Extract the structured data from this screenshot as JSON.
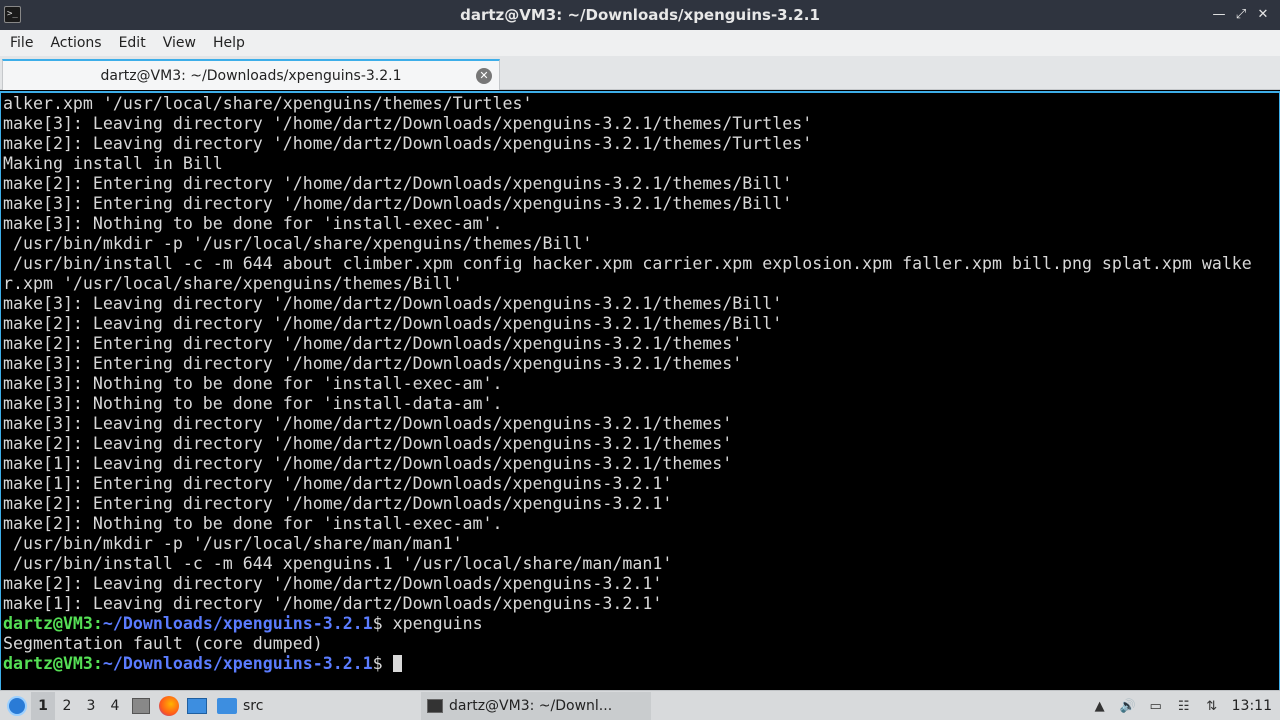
{
  "window": {
    "title": "dartz@VM3: ~/Downloads/xpenguins-3.2.1",
    "controls": [
      "minimize",
      "maximize",
      "close"
    ]
  },
  "menubar": {
    "items": [
      "File",
      "Actions",
      "Edit",
      "View",
      "Help"
    ]
  },
  "tab": {
    "label": "dartz@VM3: ~/Downloads/xpenguins-3.2.1"
  },
  "terminal": {
    "lines": [
      "alker.xpm '/usr/local/share/xpenguins/themes/Turtles'",
      "make[3]: Leaving directory '/home/dartz/Downloads/xpenguins-3.2.1/themes/Turtles'",
      "make[2]: Leaving directory '/home/dartz/Downloads/xpenguins-3.2.1/themes/Turtles'",
      "Making install in Bill",
      "make[2]: Entering directory '/home/dartz/Downloads/xpenguins-3.2.1/themes/Bill'",
      "make[3]: Entering directory '/home/dartz/Downloads/xpenguins-3.2.1/themes/Bill'",
      "make[3]: Nothing to be done for 'install-exec-am'.",
      " /usr/bin/mkdir -p '/usr/local/share/xpenguins/themes/Bill'",
      " /usr/bin/install -c -m 644 about climber.xpm config hacker.xpm carrier.xpm explosion.xpm faller.xpm bill.png splat.xpm walke",
      "r.xpm '/usr/local/share/xpenguins/themes/Bill'",
      "make[3]: Leaving directory '/home/dartz/Downloads/xpenguins-3.2.1/themes/Bill'",
      "make[2]: Leaving directory '/home/dartz/Downloads/xpenguins-3.2.1/themes/Bill'",
      "make[2]: Entering directory '/home/dartz/Downloads/xpenguins-3.2.1/themes'",
      "make[3]: Entering directory '/home/dartz/Downloads/xpenguins-3.2.1/themes'",
      "make[3]: Nothing to be done for 'install-exec-am'.",
      "make[3]: Nothing to be done for 'install-data-am'.",
      "make[3]: Leaving directory '/home/dartz/Downloads/xpenguins-3.2.1/themes'",
      "make[2]: Leaving directory '/home/dartz/Downloads/xpenguins-3.2.1/themes'",
      "make[1]: Leaving directory '/home/dartz/Downloads/xpenguins-3.2.1/themes'",
      "make[1]: Entering directory '/home/dartz/Downloads/xpenguins-3.2.1'",
      "make[2]: Entering directory '/home/dartz/Downloads/xpenguins-3.2.1'",
      "make[2]: Nothing to be done for 'install-exec-am'.",
      " /usr/bin/mkdir -p '/usr/local/share/man/man1'",
      " /usr/bin/install -c -m 644 xpenguins.1 '/usr/local/share/man/man1'",
      "make[2]: Leaving directory '/home/dartz/Downloads/xpenguins-3.2.1'",
      "make[1]: Leaving directory '/home/dartz/Downloads/xpenguins-3.2.1'"
    ],
    "prompt_user": "dartz@VM3",
    "prompt_sep": ":",
    "prompt_path": "~/Downloads/xpenguins-3.2.1",
    "prompt_symbol": "$ ",
    "command": "xpenguins",
    "output": "Segmentation fault (core dumped)"
  },
  "taskbar": {
    "workspaces": [
      "1",
      "2",
      "3",
      "4"
    ],
    "active_workspace": "1",
    "folder_label": "src",
    "task_label": "dartz@VM3: ~/Downl...",
    "clock": "13:11"
  },
  "colors": {
    "prompt_user": "#55e055",
    "prompt_path": "#5b7cff",
    "accent": "#3daee9"
  }
}
